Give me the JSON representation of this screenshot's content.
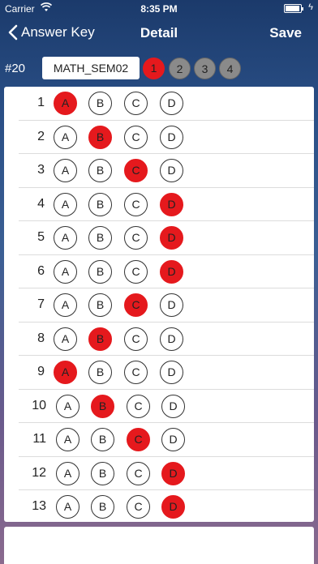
{
  "status": {
    "carrier": "Carrier",
    "time": "8:35 PM",
    "bolt": "ϟ"
  },
  "nav": {
    "back_label": "Answer Key",
    "title": "Detail",
    "save_label": "Save"
  },
  "header": {
    "number": "#20",
    "exam_name": "MATH_SEM02",
    "pages": [
      "1",
      "2",
      "3",
      "4"
    ],
    "active_page": 1
  },
  "options": [
    "A",
    "B",
    "C",
    "D"
  ],
  "questions": [
    {
      "num": "1",
      "answer": "A"
    },
    {
      "num": "2",
      "answer": "B"
    },
    {
      "num": "3",
      "answer": "C"
    },
    {
      "num": "4",
      "answer": "D"
    },
    {
      "num": "5",
      "answer": "D"
    },
    {
      "num": "6",
      "answer": "D"
    },
    {
      "num": "7",
      "answer": "C"
    },
    {
      "num": "8",
      "answer": "B"
    },
    {
      "num": "9",
      "answer": "A"
    },
    {
      "num": "10",
      "answer": "B"
    },
    {
      "num": "11",
      "answer": "C"
    },
    {
      "num": "12",
      "answer": "D"
    },
    {
      "num": "13",
      "answer": "D"
    }
  ],
  "colors": {
    "selected": "#e5191d",
    "page_inactive": "#8a8a8a"
  }
}
